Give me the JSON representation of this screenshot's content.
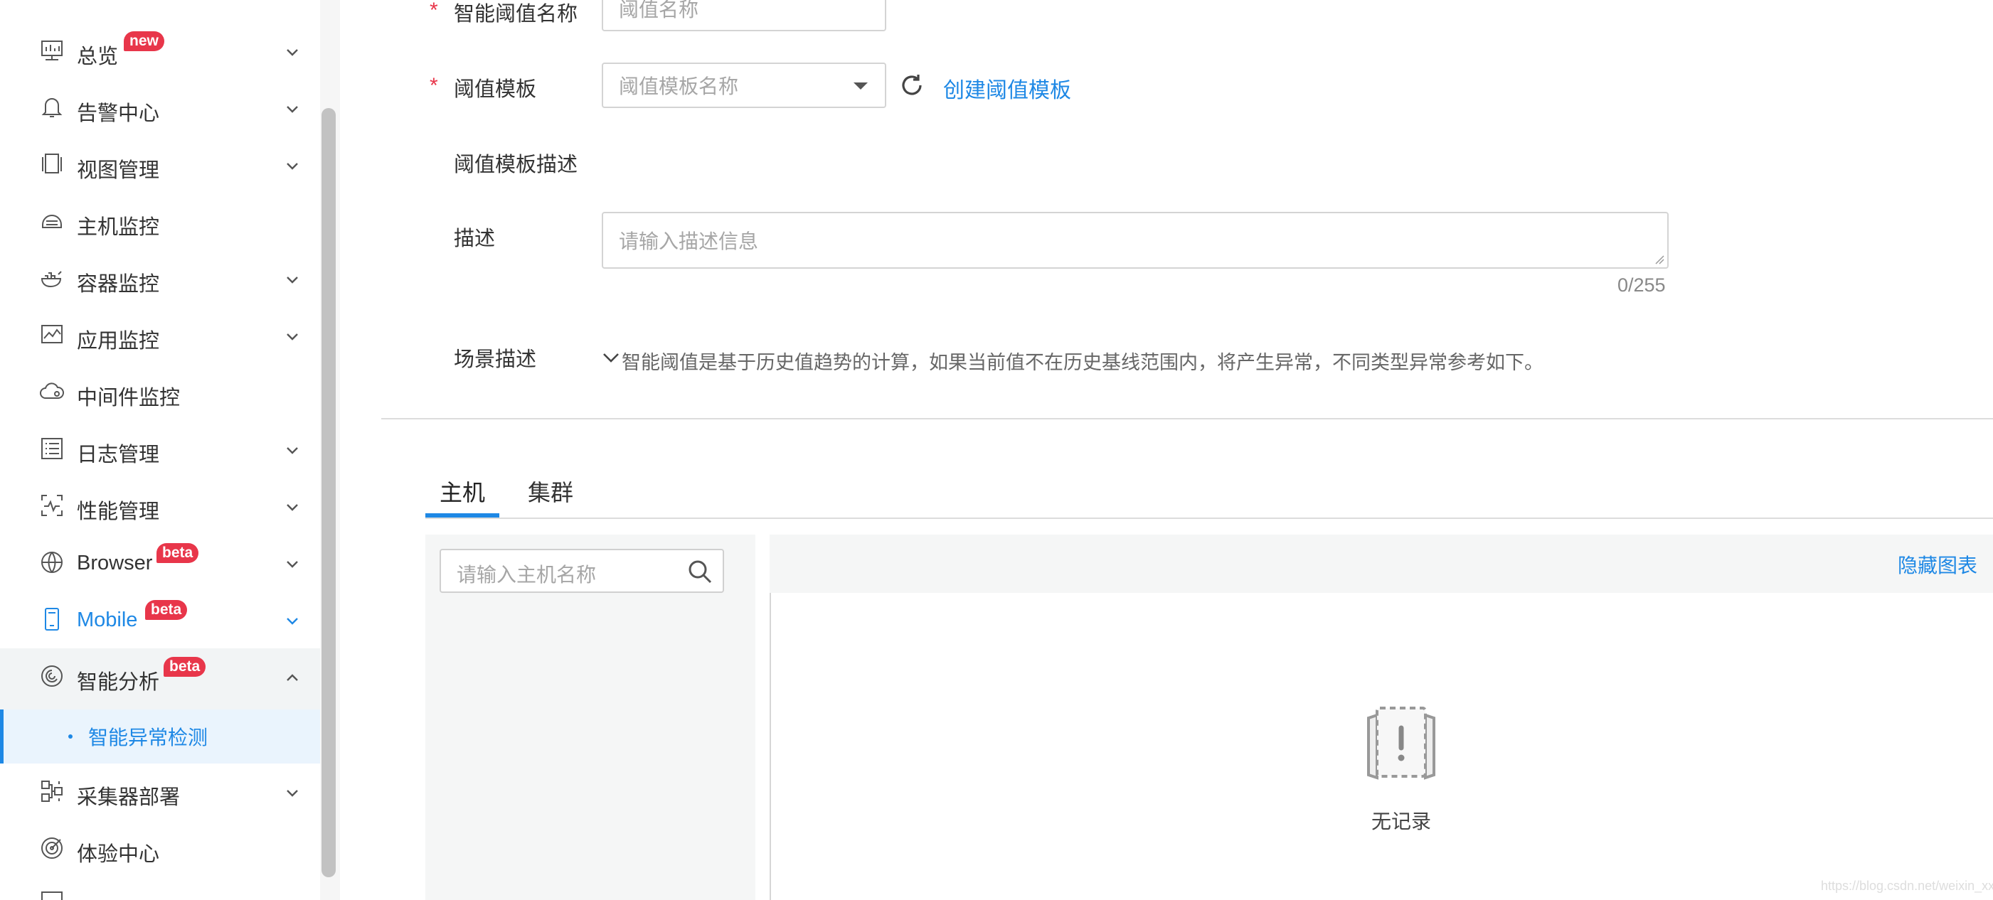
{
  "sidebar": {
    "items": [
      {
        "label": "总览",
        "badge": "new",
        "icon": "dashboard-icon"
      },
      {
        "label": "告警中心",
        "icon": "bell-icon"
      },
      {
        "label": "视图管理",
        "icon": "view-icon"
      },
      {
        "label": "主机监控",
        "icon": "host-icon"
      },
      {
        "label": "容器监控",
        "icon": "container-icon"
      },
      {
        "label": "应用监控",
        "icon": "app-chart-icon"
      },
      {
        "label": "中间件监控",
        "icon": "cloud-icon"
      },
      {
        "label": "日志管理",
        "icon": "log-icon"
      },
      {
        "label": "性能管理",
        "icon": "performance-icon"
      },
      {
        "label": "Browser",
        "badge": "beta",
        "icon": "globe-icon"
      },
      {
        "label": "Mobile",
        "badge": "beta",
        "icon": "mobile-icon"
      },
      {
        "label": "智能分析",
        "badge": "beta",
        "icon": "analysis-icon"
      },
      {
        "label": "采集器部署",
        "icon": "collector-icon"
      },
      {
        "label": "体验中心",
        "icon": "target-icon"
      }
    ],
    "sub_item": {
      "label": "智能异常检测"
    }
  },
  "form": {
    "name_label": "智能阈值名称",
    "name_placeholder": "阈值名称",
    "template_label": "阈值模板",
    "template_placeholder": "阈值模板名称",
    "create_template_link": "创建阈值模板",
    "template_desc_label": "阈值模板描述",
    "desc_label": "描述",
    "desc_placeholder": "请输入描述信息",
    "desc_counter": "0/255",
    "scene_label": "场景描述",
    "scene_text": "智能阈值是基于历史值趋势的计算，如果当前值不在历史基线范围内，将产生异常，不同类型异常参考如下。"
  },
  "tabs": [
    {
      "label": "主机",
      "active": true
    },
    {
      "label": "集群",
      "active": false
    }
  ],
  "host_panel": {
    "search_placeholder": "请输入主机名称",
    "hide_chart_link": "隐藏图表",
    "empty_text": "无记录"
  },
  "watermark": "https://blog.csdn.net/weixin_xxx",
  "colors": {
    "accent": "#1e88e5",
    "badge": "#e8364a",
    "required": "#e8364a"
  }
}
